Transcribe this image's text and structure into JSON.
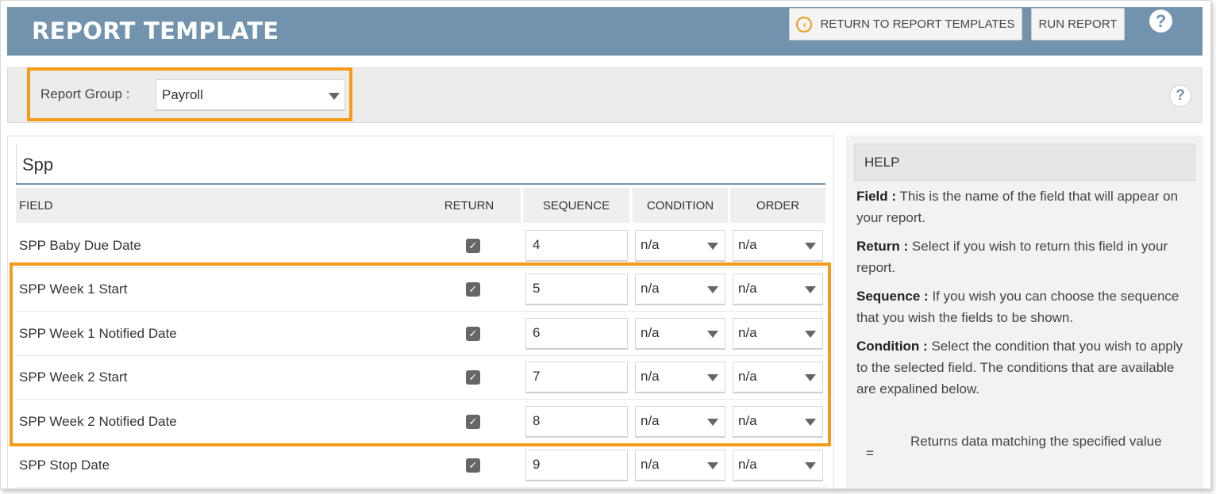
{
  "header": {
    "title": "REPORT TEMPLATE",
    "return_label": "RETURN TO REPORT TEMPLATES",
    "run_label": "RUN REPORT",
    "help_symbol": "?"
  },
  "group": {
    "label": "Report Group :",
    "value": "Payroll"
  },
  "section": {
    "title": "Spp",
    "columns": [
      "FIELD",
      "RETURN",
      "SEQUENCE",
      "CONDITION",
      "ORDER"
    ],
    "rows": [
      {
        "field": "SPP Baby Due Date",
        "returned": true,
        "sequence": "4",
        "condition": "n/a",
        "order": "n/a"
      },
      {
        "field": "SPP Week 1 Start",
        "returned": true,
        "sequence": "5",
        "condition": "n/a",
        "order": "n/a"
      },
      {
        "field": "SPP Week 1 Notified Date",
        "returned": true,
        "sequence": "6",
        "condition": "n/a",
        "order": "n/a"
      },
      {
        "field": "SPP Week 2 Start",
        "returned": true,
        "sequence": "7",
        "condition": "n/a",
        "order": "n/a"
      },
      {
        "field": "SPP Week 2 Notified Date",
        "returned": true,
        "sequence": "8",
        "condition": "n/a",
        "order": "n/a"
      },
      {
        "field": "SPP Stop Date",
        "returned": true,
        "sequence": "9",
        "condition": "n/a",
        "order": "n/a"
      }
    ]
  },
  "help": {
    "heading": "HELP",
    "items": [
      {
        "term": "Field :",
        "text": "This is the name of the field that will appear on your report."
      },
      {
        "term": "Return :",
        "text": "Select if you wish to return this field in your report."
      },
      {
        "term": "Sequence :",
        "text": "If you wish you can choose the sequence that you wish the fields to be shown."
      },
      {
        "term": "Condition :",
        "text": "Select the condition that you wish to apply to the selected field. The conditions that are available are expalined below."
      }
    ],
    "condition_symbol": "=",
    "condition_desc": "Returns data matching the specified value"
  },
  "colors": {
    "header_bg": "#7193ae",
    "highlight": "#f59b1a"
  }
}
